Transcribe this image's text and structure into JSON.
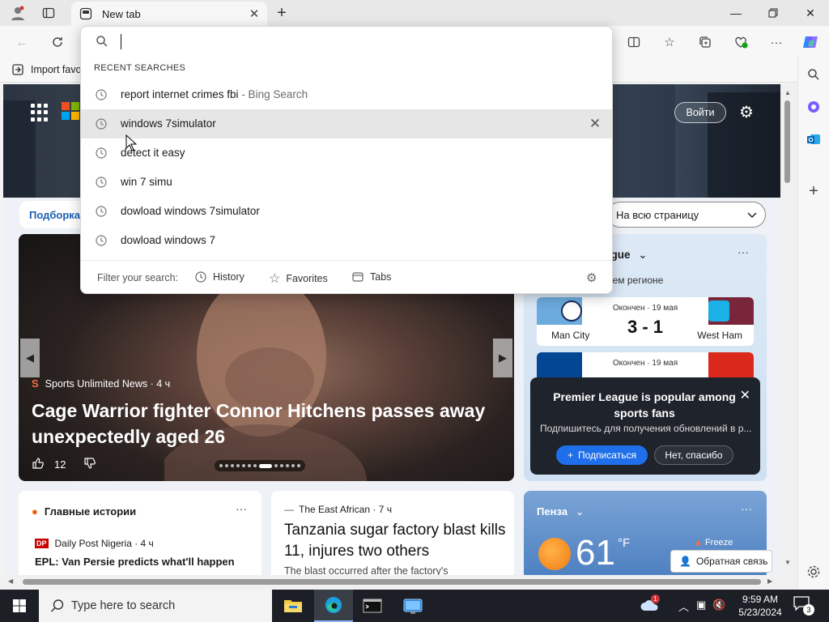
{
  "browser": {
    "tab_title": "New tab",
    "favorites_bar_item": "Import favo"
  },
  "page": {
    "sign_in": "Войти",
    "category_pill": "Подборка",
    "layout_select": "На всю страницу",
    "main_story": {
      "source": "Sports Unlimited News · 4 ч",
      "title": "Cage Warrior fighter Connor Hitchens passes away unexpectedly aged 26",
      "likes": "12"
    },
    "sports": {
      "header": "ague",
      "subheader": "шем регионе",
      "matches": [
        {
          "status": "Окончен · 19 мая",
          "score": "3 - 1",
          "home": "Man City",
          "away": "West Ham"
        },
        {
          "status": "Окончен · 19 мая",
          "score": "",
          "home": "",
          "away": ""
        }
      ]
    },
    "promo": {
      "title": "Premier League is popular among sports fans",
      "desc": "Подпишитесь для получения обновлений в р...",
      "subscribe": "Подписаться",
      "decline": "Нет, спасибо"
    },
    "top_stories": {
      "header": "Главные истории",
      "source": "Daily Post Nigeria · 4 ч",
      "source_logo": "DP",
      "headline": "EPL: Van Persie predicts what'll happen"
    },
    "east_african": {
      "source": "The East African · 7 ч",
      "title": "Tanzania sugar factory blast kills 11, injures two others",
      "excerpt": "The blast occurred after the factory's"
    },
    "weather": {
      "city": "Пенза",
      "temp": "61",
      "unit": "°F",
      "condition": "Freeze"
    },
    "feedback": "Обратная связь"
  },
  "dropdown": {
    "input_value": "",
    "section_label": "RECENT SEARCHES",
    "items": [
      {
        "text": "report internet crimes fbi",
        "suffix": " - Bing Search",
        "highlighted": false
      },
      {
        "text": "windows 7simulator",
        "suffix": "",
        "highlighted": true
      },
      {
        "text": "detect it easy",
        "suffix": "",
        "highlighted": false
      },
      {
        "text": "win 7 simu",
        "suffix": "",
        "highlighted": false
      },
      {
        "text": "dowload windows 7simulator",
        "suffix": "",
        "highlighted": false
      },
      {
        "text": "dowload windows 7",
        "suffix": "",
        "highlighted": false
      }
    ],
    "filter_label": "Filter your search:",
    "filters": [
      "History",
      "Favorites",
      "Tabs"
    ]
  },
  "taskbar": {
    "search_placeholder": "Type here to search",
    "time": "9:59 AM",
    "date": "5/23/2024",
    "notification_count": "3",
    "weather_badge": "1"
  },
  "colors": {
    "accent": "#1f6feb",
    "taskbar": "#1c1f26",
    "chrome": "#e8e8e8"
  }
}
